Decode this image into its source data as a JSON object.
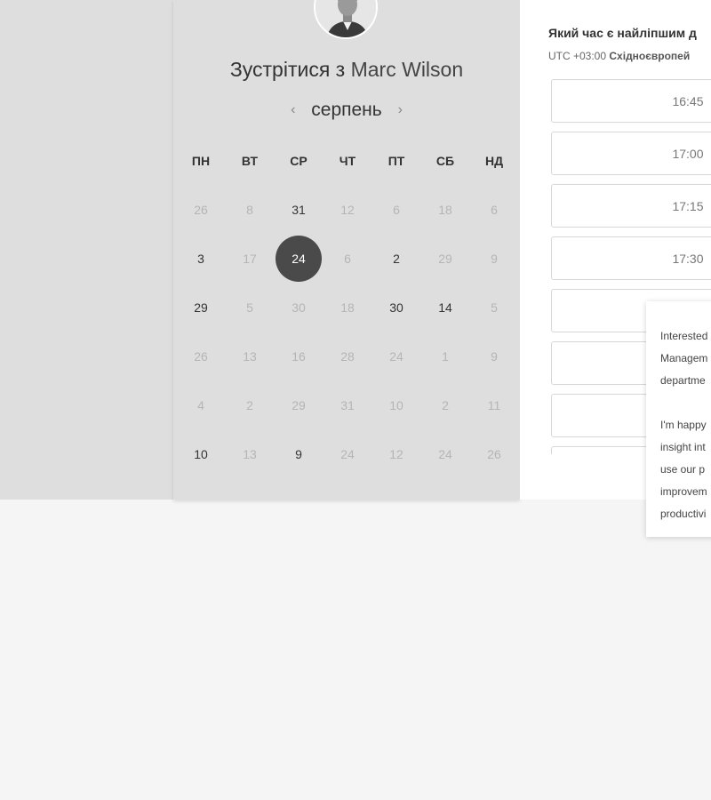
{
  "title": {
    "prefix": "Зустрітися з",
    "name": "Marc Wilson"
  },
  "calendar": {
    "month": "серпень",
    "prev_icon": "chevron-left-icon",
    "next_icon": "chevron-right-icon",
    "weekdays": [
      "ПН",
      "ВТ",
      "СР",
      "ЧТ",
      "ПТ",
      "СБ",
      "НД"
    ],
    "weeks": [
      [
        {
          "d": "26",
          "s": "muted"
        },
        {
          "d": "8",
          "s": "muted"
        },
        {
          "d": "31",
          "s": "active"
        },
        {
          "d": "12",
          "s": "muted"
        },
        {
          "d": "6",
          "s": "muted"
        },
        {
          "d": "18",
          "s": "muted"
        },
        {
          "d": "6",
          "s": "muted"
        }
      ],
      [
        {
          "d": "3",
          "s": "active"
        },
        {
          "d": "17",
          "s": "muted"
        },
        {
          "d": "24",
          "s": "selected"
        },
        {
          "d": "6",
          "s": "muted"
        },
        {
          "d": "2",
          "s": "active"
        },
        {
          "d": "29",
          "s": "muted"
        },
        {
          "d": "9",
          "s": "muted"
        }
      ],
      [
        {
          "d": "29",
          "s": "active"
        },
        {
          "d": "5",
          "s": "muted"
        },
        {
          "d": "30",
          "s": "muted"
        },
        {
          "d": "18",
          "s": "muted"
        },
        {
          "d": "30",
          "s": "active"
        },
        {
          "d": "14",
          "s": "active"
        },
        {
          "d": "5",
          "s": "muted"
        }
      ],
      [
        {
          "d": "26",
          "s": "muted"
        },
        {
          "d": "13",
          "s": "muted"
        },
        {
          "d": "16",
          "s": "muted"
        },
        {
          "d": "28",
          "s": "muted"
        },
        {
          "d": "24",
          "s": "muted"
        },
        {
          "d": "1",
          "s": "muted"
        },
        {
          "d": "9",
          "s": "muted"
        }
      ],
      [
        {
          "d": "4",
          "s": "muted"
        },
        {
          "d": "2",
          "s": "muted"
        },
        {
          "d": "29",
          "s": "muted"
        },
        {
          "d": "31",
          "s": "muted"
        },
        {
          "d": "10",
          "s": "muted"
        },
        {
          "d": "2",
          "s": "muted"
        },
        {
          "d": "11",
          "s": "muted"
        }
      ],
      [
        {
          "d": "10",
          "s": "active"
        },
        {
          "d": "13",
          "s": "muted"
        },
        {
          "d": "9",
          "s": "active"
        },
        {
          "d": "24",
          "s": "muted"
        },
        {
          "d": "12",
          "s": "muted"
        },
        {
          "d": "24",
          "s": "muted"
        },
        {
          "d": "26",
          "s": "muted"
        }
      ]
    ]
  },
  "times": {
    "question": "Який час є найліпшим д",
    "timezone_prefix": "UTC +03:00",
    "timezone_name": "Східноєвропей",
    "slots": [
      "16:45",
      "17:00",
      "17:15",
      "17:30",
      "",
      "",
      "",
      ""
    ]
  },
  "popup": {
    "lines": [
      "Interested",
      "Managem",
      "departme",
      "",
      "I'm happy",
      "insight int",
      "use our p",
      "improvem",
      "productivi"
    ]
  },
  "colors": {
    "selected_day": "#4a4a4a",
    "panel_bg": "#dedede",
    "page_bg": "#f5f5f5"
  }
}
